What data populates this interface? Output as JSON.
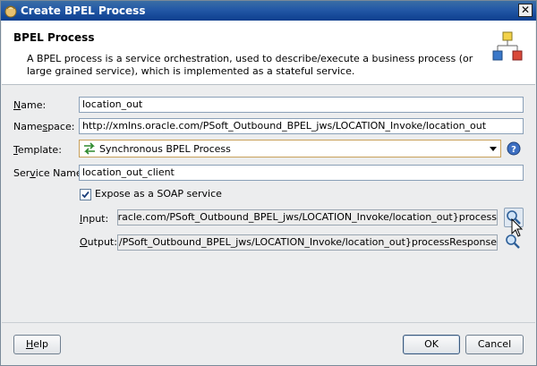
{
  "window": {
    "title": "Create BPEL Process",
    "close_glyph": "✕"
  },
  "header": {
    "title": "BPEL Process",
    "description": "A BPEL process is a service orchestration, used to describe/execute a business process (or large grained service), which is implemented as a stateful service.",
    "icon": "bpel-diagram-icon"
  },
  "form": {
    "name": {
      "label_pre": "",
      "label_u": "N",
      "label_post": "ame:",
      "value": "location_out"
    },
    "namespace": {
      "label_pre": "Name",
      "label_u": "s",
      "label_post": "pace:",
      "value": "http://xmlns.oracle.com/PSoft_Outbound_BPEL_jws/LOCATION_Invoke/location_out"
    },
    "template": {
      "label_pre": "",
      "label_u": "T",
      "label_post": "emplate:",
      "value": "Synchronous BPEL Process",
      "icon": "sync-arrows-icon"
    },
    "service_name": {
      "label_pre": "Ser",
      "label_u": "v",
      "label_post": "ice Name:",
      "value": "location_out_client"
    },
    "expose_soap": {
      "label_pre": "",
      "label_u": "E",
      "label_post": "xpose as a SOAP service",
      "checked": true
    },
    "input": {
      "label_pre": "",
      "label_u": "I",
      "label_post": "nput:",
      "value": "{http://xmlns.oracle.com/PSoft_Outbound_BPEL_jws/LOCATION_Invoke/location_out}process"
    },
    "output": {
      "label_pre": "",
      "label_u": "O",
      "label_post": "utput:",
      "value": "{http://xmlns.oracle.com/PSoft_Outbound_BPEL_jws/LOCATION_Invoke/location_out}processResponse"
    }
  },
  "buttons": {
    "help": {
      "pre": "",
      "u": "H",
      "post": "elp"
    },
    "ok": "OK",
    "cancel": "Cancel"
  },
  "colors": {
    "titlebar": "#2358a6",
    "select_border": "#c8a05a",
    "field_border": "#8aa0b7"
  }
}
